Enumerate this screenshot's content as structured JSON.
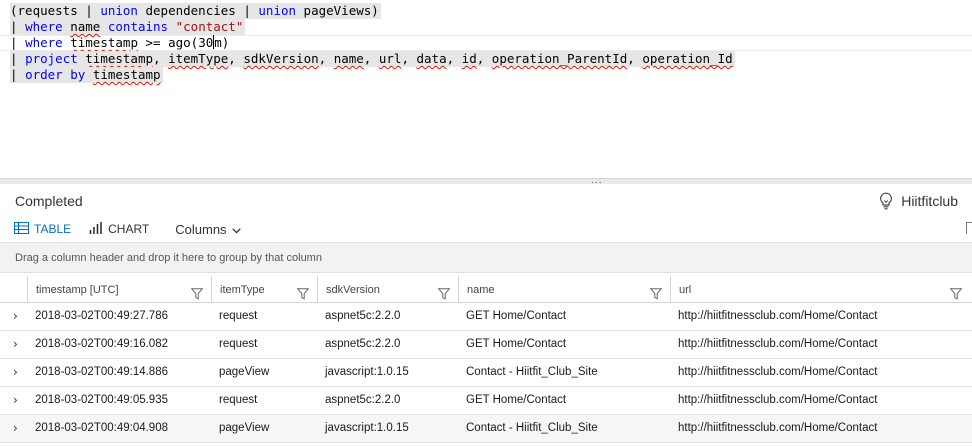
{
  "editor": {
    "line1": {
      "open": "(requests ",
      "op1": "| ",
      "kw1": "union",
      "mid": " dependencies ",
      "op2": "| ",
      "kw2": "union",
      "end": " pageViews)"
    },
    "line2": {
      "pipe": "| ",
      "where": "where",
      "sp1": " ",
      "name": "name",
      "sp2": " ",
      "contains": "contains",
      "sp3": " ",
      "value": "\"contact\""
    },
    "line3": {
      "pipe": "| ",
      "where": "where",
      "sp1": " ",
      "field": "timestamp",
      "op": " >= ago(",
      "num": "30",
      "unit": "m)"
    },
    "line4": {
      "pipe": "| ",
      "project": "project",
      "sp1": " ",
      "c1": "timestamp",
      "sep1": ", ",
      "c2": "itemType",
      "sep2": ", ",
      "c3": "sdkVersion",
      "sep3": ", ",
      "c4": "name",
      "sep4": ", ",
      "c5": "url",
      "sep5": ", ",
      "c6": "data",
      "sep6": ", ",
      "c7": "id",
      "sep7": ", ",
      "c8": "operation_ParentId",
      "sep8": ", ",
      "c9": "operation_Id"
    },
    "line5": {
      "pipe": "| ",
      "order": "order",
      "sp1": " ",
      "by": "by",
      "sp2": " ",
      "field": "timestamp"
    }
  },
  "splitter": {
    "grip": "..."
  },
  "results": {
    "status": "Completed",
    "resource_name": "Hiitfitclub",
    "resource_icon": "lightbulb-icon"
  },
  "toolbar": {
    "table_label": "TABLE",
    "chart_label": "CHART",
    "columns_label": "Columns",
    "accent": "#0072c6"
  },
  "group_hint": "Drag a column header and drop it here to group by that column",
  "table": {
    "columns": [
      "timestamp [UTC]",
      "itemType",
      "sdkVersion",
      "name",
      "url"
    ],
    "rows": [
      [
        "2018-03-02T00:49:27.786",
        "request",
        "aspnet5c:2.2.0",
        "GET Home/Contact",
        "http://hiitfitnessclub.com/Home/Contact"
      ],
      [
        "2018-03-02T00:49:16.082",
        "request",
        "aspnet5c:2.2.0",
        "GET Home/Contact",
        "http://hiitfitnessclub.com/Home/Contact"
      ],
      [
        "2018-03-02T00:49:14.886",
        "pageView",
        "javascript:1.0.15",
        "Contact - Hiitfit_Club_Site",
        "http://hiitfitnessclub.com/Home/Contact"
      ],
      [
        "2018-03-02T00:49:05.935",
        "request",
        "aspnet5c:2.2.0",
        "GET Home/Contact",
        "http://hiitfitnessclub.com/Home/Contact"
      ],
      [
        "2018-03-02T00:49:04.908",
        "pageView",
        "javascript:1.0.15",
        "Contact - Hiitfit_Club_Site",
        "http://hiitfitnessclub.com/Home/Contact"
      ]
    ]
  }
}
